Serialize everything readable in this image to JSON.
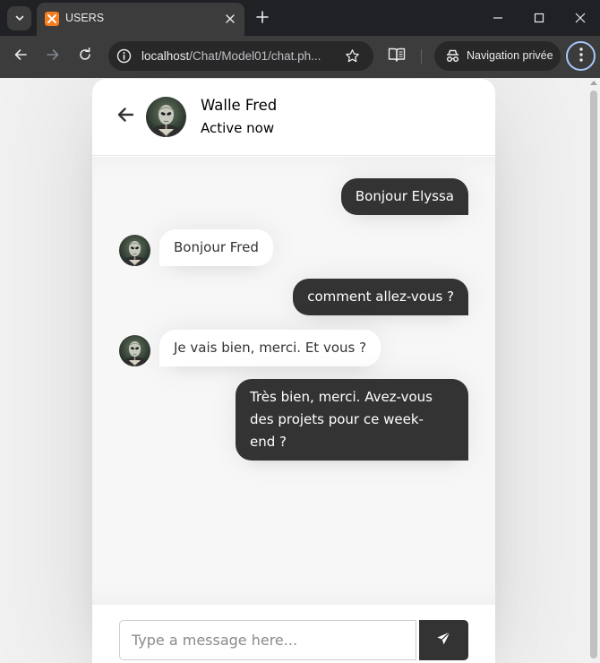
{
  "browser": {
    "tab": {
      "title": "USERS",
      "favicon": "xampp-favicon-icon"
    },
    "address_bar": {
      "url_host": "localhost",
      "url_path": "/Chat/Model01/chat.ph..."
    },
    "incognito_label": "Navigation privée",
    "colors": {
      "frame": "#202124",
      "toolbar": "#3c3c3c",
      "omnibox": "#282828",
      "menu_ring": "#a8c7fa",
      "favicon": "#f57c1f"
    }
  },
  "chat": {
    "header": {
      "name": "Walle Fred",
      "status": "Active now",
      "avatar": "alien-avatar-icon"
    },
    "messages": [
      {
        "direction": "outgoing",
        "text": "Bonjour Elyssa"
      },
      {
        "direction": "incoming",
        "text": "Bonjour Fred",
        "avatar": "alien-avatar-icon"
      },
      {
        "direction": "outgoing",
        "text": "comment allez-vous ?"
      },
      {
        "direction": "incoming",
        "text": "Je vais bien, merci. Et vous ?",
        "avatar": "alien-avatar-icon"
      },
      {
        "direction": "outgoing",
        "text_lines": [
          "Très bien, merci. Avez-vous",
          "des projets pour ce week-",
          "end ?"
        ]
      }
    ],
    "input": {
      "placeholder": "Type a message here...",
      "value": ""
    },
    "send_icon": "paper-plane-icon",
    "colors": {
      "outgoing_bubble": "#333333",
      "incoming_bubble": "#ffffff",
      "chat_background": "#f7f7f7",
      "page_background": "#f1f1f1"
    }
  }
}
